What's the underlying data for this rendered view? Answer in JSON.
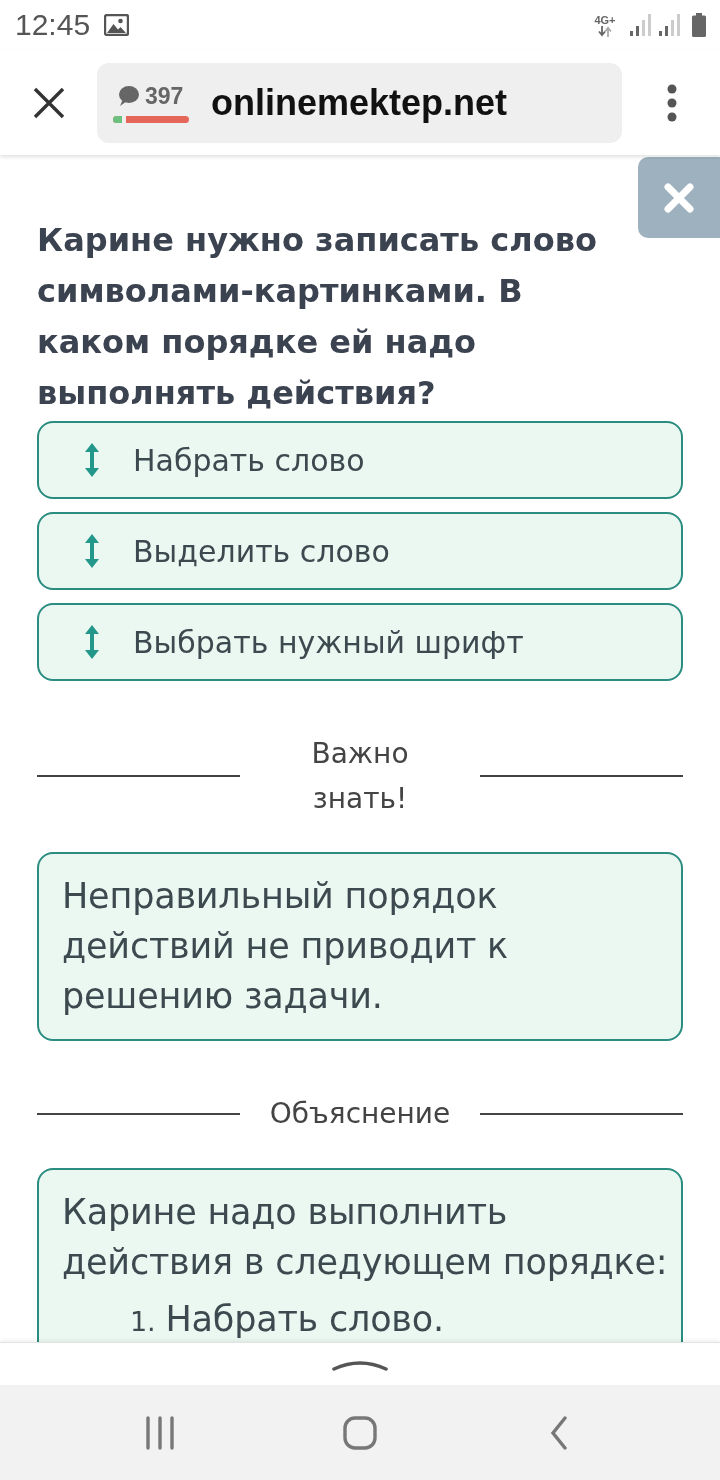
{
  "status_bar": {
    "time": "12:45",
    "network": "4G+"
  },
  "browser": {
    "comments_count": "397",
    "rating": {
      "level": 0.12
    },
    "url": "onlinemektep.net"
  },
  "question": {
    "text": "Карине нужно записать слово символами-картинками. В каком порядке ей надо выполнять действия?"
  },
  "answers": [
    {
      "label": "Набрать слово"
    },
    {
      "label": "Выделить слово"
    },
    {
      "label": "Выбрать нужный шрифт"
    }
  ],
  "important": {
    "heading": "Важно знать!",
    "text": "Неправильный порядок действий не приводит к решению задачи."
  },
  "explanation": {
    "heading": "Объяснение",
    "text": "Карине надо выполнить действия в следующем порядке:",
    "steps": [
      {
        "number": "1.",
        "text": "Набрать слово."
      }
    ]
  }
}
